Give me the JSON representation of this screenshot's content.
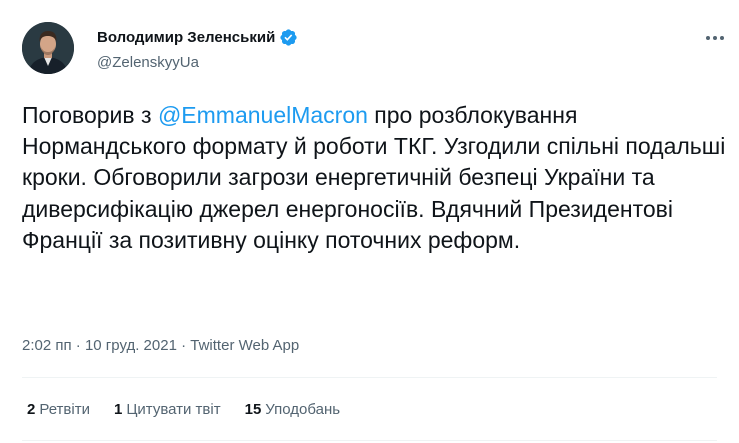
{
  "author": {
    "display_name": "Володимир Зеленський",
    "handle": "@ZelenskyyUa",
    "verified_icon": "verified-badge-icon",
    "avatar_icon": "avatar-photo"
  },
  "tweet": {
    "text_before": "Поговорив з ",
    "mention": "@EmmanuelMacron",
    "text_after": " про розблокування Нормандського формату й роботи ТКГ. Узгодили спільні подальші кроки. Обговорили загрози енергетичній безпеці України та диверсифікацію джерел енергоносіїв. Вдячний Президентові Франції за позитивну оцінку поточних реформ.",
    "time": "2:02 пп",
    "separator": "·",
    "date": "10 груд. 2021",
    "source": "Twitter Web App"
  },
  "stats": {
    "retweets_count": "2",
    "retweets_label": "Ретвіти",
    "quotes_count": "1",
    "quotes_label": "Цитувати твіт",
    "likes_count": "15",
    "likes_label": "Уподобань"
  },
  "colors": {
    "accent": "#1d9bf0",
    "text": "#0f1419",
    "secondary": "#536471",
    "divider": "#eff3f4"
  }
}
